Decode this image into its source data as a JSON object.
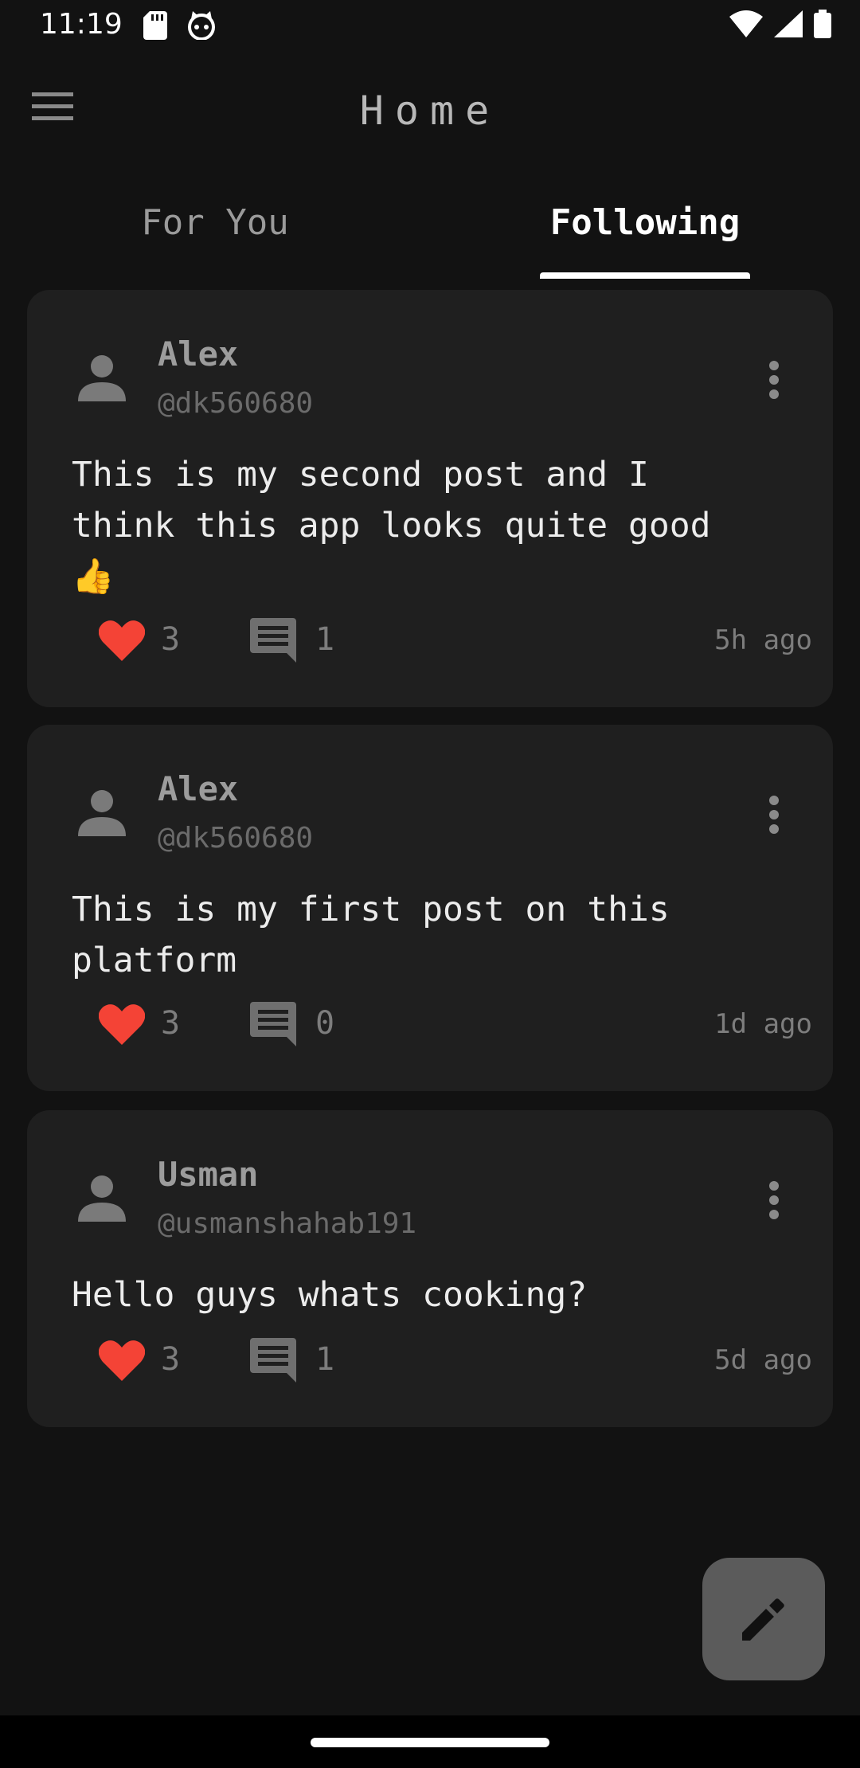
{
  "status_bar": {
    "time": "11:19",
    "left_icons": [
      "sd-card-icon",
      "cat-face-icon"
    ],
    "right_icons": [
      "wifi-icon",
      "signal-icon",
      "battery-icon"
    ]
  },
  "app_bar": {
    "title": "Home",
    "menu_icon": "menu-icon"
  },
  "tabs": {
    "items": [
      {
        "label": "For You",
        "selected": false
      },
      {
        "label": "Following",
        "selected": true
      }
    ]
  },
  "posts": [
    {
      "author": "Alex",
      "handle": "@dk560680",
      "text": "This is my second post and I\nthink this app looks quite good\n👍",
      "likes": "3",
      "comments": "1",
      "time": "5h ago"
    },
    {
      "author": "Alex",
      "handle": "@dk560680",
      "text": "This is my first post on this\nplatform",
      "likes": "3",
      "comments": "0",
      "time": "1d ago"
    },
    {
      "author": "Usman",
      "handle": "@usmanshahab191",
      "text": "Hello guys whats cooking?",
      "likes": "3",
      "comments": "1",
      "time": "5d ago"
    }
  ],
  "fab": {
    "icon": "pencil-icon"
  },
  "colors": {
    "background": "#121212",
    "card": "#1f1f1f",
    "like": "#f44336",
    "fab": "#5b5b5b"
  }
}
